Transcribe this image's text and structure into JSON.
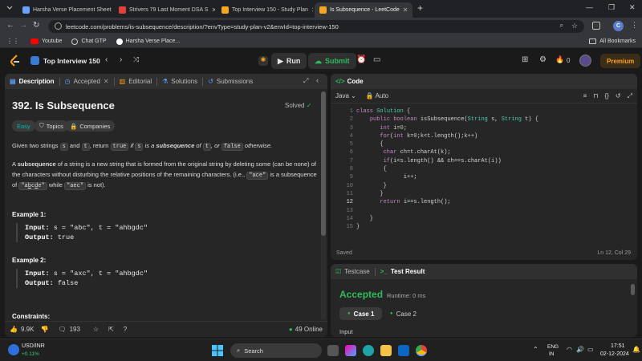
{
  "browser": {
    "tabs": [
      {
        "title": "Harsha Verse Placement Sheet",
        "color": "#6aa0ff"
      },
      {
        "title": "Strivers 79 Last Moment DSA S",
        "color": "#e0413a"
      },
      {
        "title": "Top Interview 150 - Study Plan",
        "color": "#f5a623"
      },
      {
        "title": "Is Subsequence - LeetCode",
        "color": "#f5a623"
      }
    ],
    "url": "leetcode.com/problems/is-subsequence/description/?envType=study-plan-v2&envId=top-interview-150",
    "profile_initial": "C",
    "bookmarks": [
      {
        "label": "Youtube",
        "color": "#ff0000"
      },
      {
        "label": "Chat GTP",
        "color": "#cfcfcf"
      },
      {
        "label": "Harsha Verse Place...",
        "color": "#ffffff"
      }
    ],
    "all_bookmarks": "All Bookmarks"
  },
  "lc": {
    "study_plan": "Top Interview 150",
    "run": "Run",
    "submit": "Submit",
    "streak": "0",
    "premium": "Premium"
  },
  "left": {
    "tabs": [
      "Description",
      "Accepted",
      "Editorial",
      "Solutions",
      "Submissions"
    ],
    "title": "392. Is Subsequence",
    "status": "Solved",
    "difficulty": "Easy",
    "topics": "Topics",
    "companies": "Companies",
    "desc1": {
      "a": "Given two strings ",
      "s": "s",
      "b": " and ",
      "t": "t",
      "c": ", return ",
      "true": "true",
      "d": " if ",
      "s2": "s",
      "e": " is a ",
      "sub": "subsequence",
      "f": " of ",
      "t2": "t",
      "g": ", or ",
      "false": "false",
      "h": " otherwise."
    },
    "desc2": {
      "a": "A ",
      "sub": "subsequence",
      "b": " of a string is a new string that is formed from the original string by deleting some (can be none) of the characters without disturbing the relative positions of the remaining characters. (i.e., ",
      "ace": "\"ace\"",
      "c": " is a subsequence of ",
      "abcde_pre": "\"a",
      "abcde_b": "b",
      "abcde_c": "c",
      "abcde_d": "d",
      "abcde_e": "e\"",
      "d": " while ",
      "aec": "\"aec\"",
      "e": " is not)."
    },
    "ex1_title": "Example 1:",
    "ex1_input_label": "Input:",
    "ex1_input": " s = \"abc\", t = \"ahbgdc\"",
    "ex1_output_label": "Output:",
    "ex1_output": " true",
    "ex2_title": "Example 2:",
    "ex2_input_label": "Input:",
    "ex2_input": " s = \"axc\", t = \"ahbgdc\"",
    "ex2_output_label": "Output:",
    "ex2_output": " false",
    "constraints": "Constraints:",
    "likes": "9.9K",
    "comments": "193",
    "online": "49 Online"
  },
  "code": {
    "title": "Code",
    "language": "Java",
    "mode": "Auto",
    "lines": [
      "class Solution {",
      "    public boolean isSubsequence(String s, String t) {",
      "       int i=0;",
      "       for(int k=0;k<t.length();k++)",
      "       {",
      "        char ch=t.charAt(k);",
      "        if(i<s.length() && ch==s.charAt(i))",
      "        {",
      "              i++;",
      "        }",
      "       }",
      "       return i==s.length();",
      "",
      "    }",
      "}"
    ],
    "saved": "Saved",
    "cursor": "Ln 12, Col 29"
  },
  "result": {
    "tab_testcase": "Testcase",
    "tab_result": "Test Result",
    "verdict": "Accepted",
    "runtime": "Runtime: 0 ms",
    "case1": "Case 1",
    "case2": "Case 2",
    "input_label": "Input"
  },
  "taskbar": {
    "stock": "USD/INR",
    "change": "+0.11%",
    "search": "Search",
    "lang1": "ENG",
    "lang2": "IN",
    "time": "17:51",
    "date": "02-12-2024"
  },
  "colors": {
    "accent_green": "#2cbb5d",
    "easy": "#00b8a3",
    "premium": "#ffa116",
    "link_blue": "#5ea0ff"
  }
}
